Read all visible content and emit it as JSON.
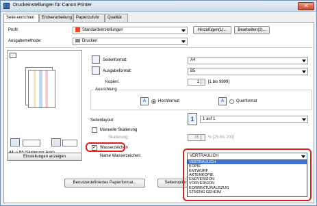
{
  "window": {
    "title": "Druckeinstellungen für Canon Printer",
    "close_label": "✕"
  },
  "tabs": [
    {
      "label": "Seite einrichten",
      "active": true
    },
    {
      "label": "Endverarbeitung",
      "active": false
    },
    {
      "label": "Papierzufuhr",
      "active": false
    },
    {
      "label": "Qualität",
      "active": false
    }
  ],
  "profile": {
    "label": "Profil:",
    "value": "Standardeinstellungen",
    "add_button": "Hinzufügen(1)...",
    "edit_button": "Bearbeiten(2)..."
  },
  "output_method": {
    "label": "Ausgabemethode:",
    "value": "Drucken"
  },
  "page_size": {
    "label": "Seitenformat:",
    "value": "A4"
  },
  "output_size": {
    "label": "Ausgabeformat:",
    "value": "B5"
  },
  "copies": {
    "label": "Kopien:",
    "value": "1",
    "range": "[1 bis 9999]"
  },
  "orientation": {
    "label": "Ausrichtung",
    "portrait": "Hochformat",
    "landscape": "Querformat",
    "selected": "portrait"
  },
  "page_layout": {
    "label": "Seitenlayout:",
    "value": "1 auf 1"
  },
  "manual_scaling": {
    "label": "Manuelle Skalierung",
    "scaling_label": "Skalierung:",
    "scaling_value": "86",
    "scaling_range": "% [25 bis 200]"
  },
  "preview": {
    "caption": "A4 -> B5 (Skalierung: Auto)",
    "settings_button": "Einstellungen anzeigen"
  },
  "watermark": {
    "checkbox_label": "Wasserzeichen",
    "checked": true,
    "name_label": "Name Wasserzeichen:",
    "selected": "VERTRAULICH",
    "options": [
      "VERTRAULICH",
      "KOPIE",
      "ENTWURF",
      "AKTENKOPIE",
      "ENDVERSION",
      "VORVERSION",
      "KORREKTURAUSZUG",
      "STRENG GEHEIM"
    ]
  },
  "bottom_buttons": {
    "custom_paper": "Benutzerdefiniertes Papierformat...",
    "page_options": "Seitenoptionen..."
  },
  "colors": {
    "highlight": "#d91c1c",
    "selection": "#3a74d0"
  }
}
